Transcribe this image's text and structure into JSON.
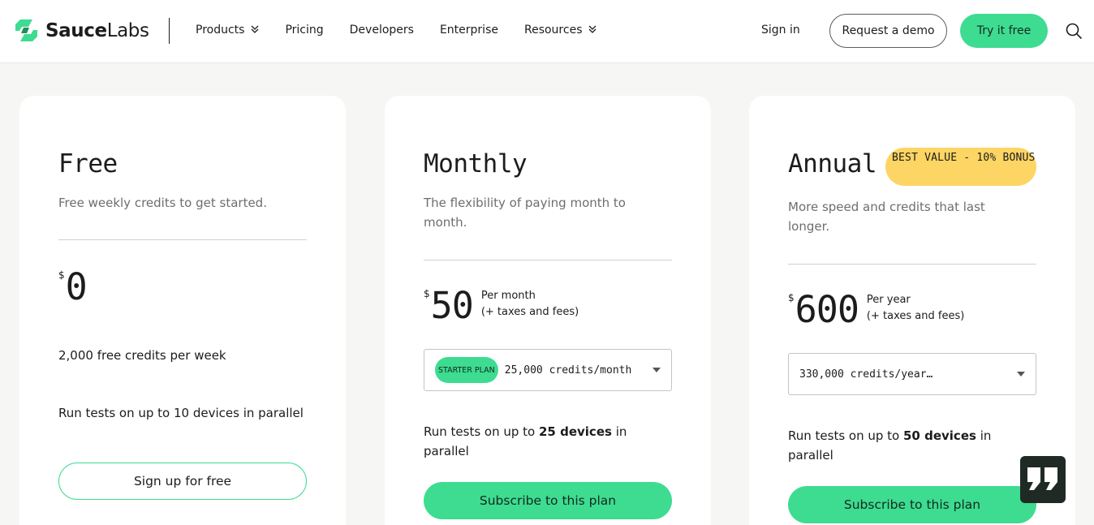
{
  "header": {
    "logo_sauce": "Sauce",
    "logo_labs": "Labs",
    "nav": [
      {
        "label": "Products",
        "has_dropdown": true
      },
      {
        "label": "Pricing",
        "has_dropdown": false
      },
      {
        "label": "Developers",
        "has_dropdown": false
      },
      {
        "label": "Enterprise",
        "has_dropdown": false
      },
      {
        "label": "Resources",
        "has_dropdown": true
      }
    ],
    "signin": "Sign in",
    "demo_button": "Request a demo",
    "try_button": "Try it free",
    "search_icon": "search-icon"
  },
  "plans": {
    "free": {
      "title": "Free",
      "subtitle": "Free weekly credits to get started.",
      "currency": "$",
      "amount": "0",
      "credits": "2,000 free credits per week",
      "devices": "Run tests on up to 10 devices in parallel",
      "button": "Sign up for free"
    },
    "monthly": {
      "title": "Monthly",
      "subtitle": "The flexibility of paying month to month.",
      "currency": "$",
      "amount": "50",
      "price_note_1": "Per month",
      "price_note_2": "(+ taxes and fees)",
      "badge": "STARTER PLAN",
      "select_value": "25,000 credits/month",
      "devices_pre": "Run tests on up to ",
      "devices_bold": "25 devices",
      "devices_post": " in parallel",
      "button": "Subscribe to this plan"
    },
    "annual": {
      "title": "Annual",
      "badge": "BEST VALUE - 10% BONUS",
      "subtitle": "More speed and credits that last longer.",
      "currency": "$",
      "amount": "600",
      "price_note_1": "Per year",
      "price_note_2": "(+ taxes and fees)",
      "select_value": "330,000 credits/year…",
      "devices_pre": "Run tests on up to ",
      "devices_bold": "50 devices",
      "devices_post": " in parallel",
      "button": "Subscribe to this plan"
    }
  },
  "widget": {
    "icon": "quote-icon"
  },
  "colors": {
    "accent": "#3ddc91",
    "badge_yellow": "#fdd564",
    "background": "#f6f6f4"
  }
}
